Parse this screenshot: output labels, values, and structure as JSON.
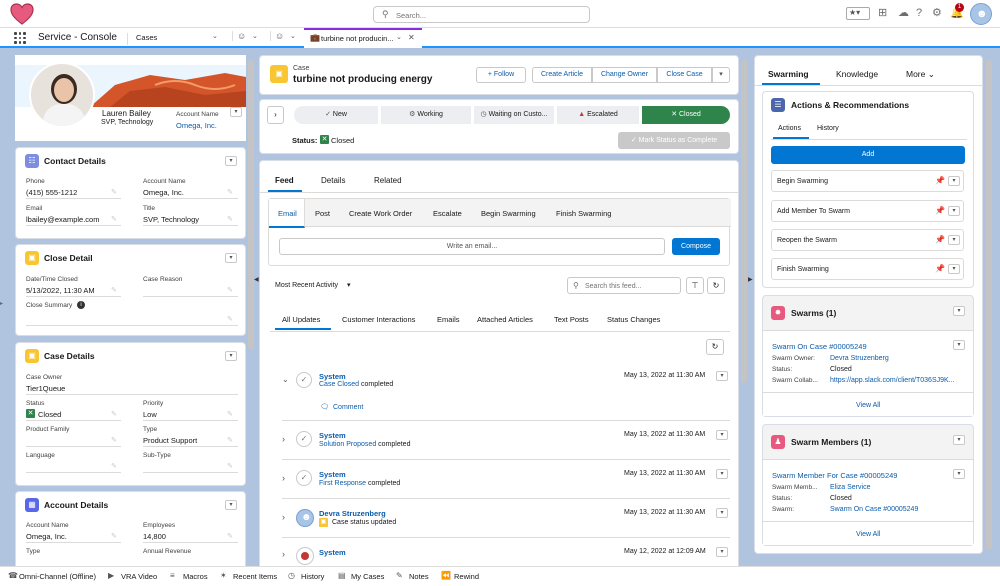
{
  "header": {
    "search_placeholder": "Search...",
    "notification_count": "1"
  },
  "nav": {
    "app_name": "Service - Console",
    "object_tab": "Cases",
    "active_tab": "turbine not producin..."
  },
  "profile": {
    "name": "Lauren Bailey",
    "title": "SVP, Technology",
    "account_name_label": "Account Name",
    "account_name": "Omega, Inc."
  },
  "contact_details": {
    "title": "Contact Details",
    "phone_label": "Phone",
    "phone": "(415) 555-1212",
    "account_label": "Account Name",
    "account": "Omega, Inc.",
    "email_label": "Email",
    "email": "lbailey@example.com",
    "title_label": "Title",
    "title_value": "SVP, Technology"
  },
  "close_detail": {
    "title": "Close Detail",
    "closed_label": "Date/Time Closed",
    "closed": "5/13/2022, 11:30 AM",
    "reason_label": "Case Reason",
    "summary_label": "Close Summary"
  },
  "case_details": {
    "title": "Case Details",
    "owner_label": "Case Owner",
    "owner": "Tier1Queue",
    "status_label": "Status",
    "status": "Closed",
    "priority_label": "Priority",
    "priority": "Low",
    "family_label": "Product Family",
    "type_label": "Type",
    "type": "Product Support",
    "language_label": "Language",
    "subtype_label": "Sub-Type"
  },
  "account_details": {
    "title": "Account Details",
    "name_label": "Account Name",
    "name": "Omega, Inc.",
    "employees_label": "Employees",
    "employees": "14,800",
    "type_label": "Type",
    "revenue_label": "Annual Revenue"
  },
  "case": {
    "object_label": "Case",
    "subject": "turbine not producing energy",
    "actions": [
      "Follow",
      "Create Article",
      "Change Owner",
      "Close Case"
    ],
    "path": [
      "New",
      "Working",
      "Waiting on Custo...",
      "Escalated",
      "Closed"
    ],
    "status_label": "Status:",
    "status": "Closed",
    "mark_complete": "Mark Status as Complete"
  },
  "feed": {
    "tabs": [
      "Feed",
      "Details",
      "Related"
    ],
    "publisher_tabs": [
      "Email",
      "Post",
      "Create Work Order",
      "Escalate",
      "Begin Swarming",
      "Finish Swarming"
    ],
    "email_placeholder": "Write an email...",
    "compose": "Compose",
    "sort": "Most Recent Activity",
    "search_placeholder": "Search this feed...",
    "filters": [
      "All Updates",
      "Customer Interactions",
      "Emails",
      "Attached Articles",
      "Text Posts",
      "Status Changes"
    ],
    "items": [
      {
        "author": "System",
        "link": "Case Closed",
        "text": " completed",
        "time": "May 13, 2022 at 11:30 AM",
        "extra": "Comment"
      },
      {
        "author": "System",
        "link": "Solution Proposed",
        "text": " completed",
        "time": "May 13, 2022 at 11:30 AM"
      },
      {
        "author": "System",
        "link": "First Response",
        "text": " completed",
        "time": "May 13, 2022 at 11:30 AM"
      },
      {
        "author": "Devra Struzenberg",
        "link": "",
        "text": "Case status updated",
        "time": "May 13, 2022 at 11:30 AM"
      },
      {
        "author": "System",
        "link": "",
        "text": "",
        "time": "May 12, 2022 at 12:09 AM"
      }
    ]
  },
  "right": {
    "tabs": [
      "Swarming",
      "Knowledge",
      "More"
    ],
    "ar_title": "Actions & Recommendations",
    "ar_tabs": [
      "Actions",
      "History"
    ],
    "add": "Add",
    "actions": [
      "Begin Swarming",
      "Add Member To Swarm",
      "Reopen the Swarm",
      "Finish Swarming"
    ],
    "swarms_title": "Swarms (1)",
    "swarm_link": "Swarm On Case #00005249",
    "swarm_owner_label": "Swarm Owner:",
    "swarm_owner": "Devra Struzenberg",
    "swarm_status_label": "Status:",
    "swarm_status": "Closed",
    "swarm_collab_label": "Swarm Collab...",
    "swarm_collab": "https://app.slack.com/client/T036SJ9K...",
    "view_all": "View All",
    "members_title": "Swarm Members (1)",
    "member_link": "Swarm Member For Case #00005249",
    "member_label": "Swarm Memb...",
    "member": "Eliza Service",
    "member_status_label": "Status:",
    "member_status": "Closed",
    "member_swarm_label": "Swarm:",
    "member_swarm": "Swarm On Case #00005249"
  },
  "footer": [
    "Omni-Channel (Offline)",
    "VRA Video",
    "Macros",
    "Recent Items",
    "History",
    "My Cases",
    "Notes",
    "Rewind"
  ]
}
